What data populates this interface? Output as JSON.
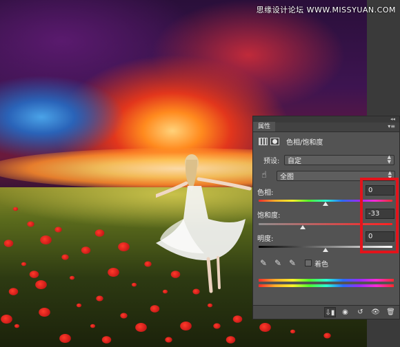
{
  "watermark": {
    "text": "思缘设计论坛 WWW.MISSYUAN.COM"
  },
  "panel": {
    "strip_glyph": "◂◂",
    "tab_label": "属性",
    "menu_glyph": "▾≡",
    "adjustment_title": "色相/饱和度",
    "header_icons": [
      "adjustment-grid-icon",
      "layer-mask-icon"
    ],
    "preset_label": "预设:",
    "preset_value": "自定",
    "channel_value": "全图",
    "hue": {
      "label": "色相:",
      "value": "0",
      "level_percent": 50
    },
    "saturation": {
      "label": "饱和度:",
      "value": "-33",
      "level_percent": 33
    },
    "lightness": {
      "label": "明度:",
      "value": "0",
      "level_percent": 50
    },
    "colorize_label": "着色",
    "colorize_checked": false,
    "tools": [
      "eyedropper-icon",
      "eyedropper-plus-icon",
      "eyedropper-minus-icon"
    ],
    "bottom_buttons": [
      "clip-to-layer-icon",
      "view-previous-icon",
      "reset-icon",
      "visibility-eye-icon",
      "trash-icon"
    ]
  },
  "colors": {
    "panel_bg": "#535353",
    "highlight": "#e3131b"
  }
}
